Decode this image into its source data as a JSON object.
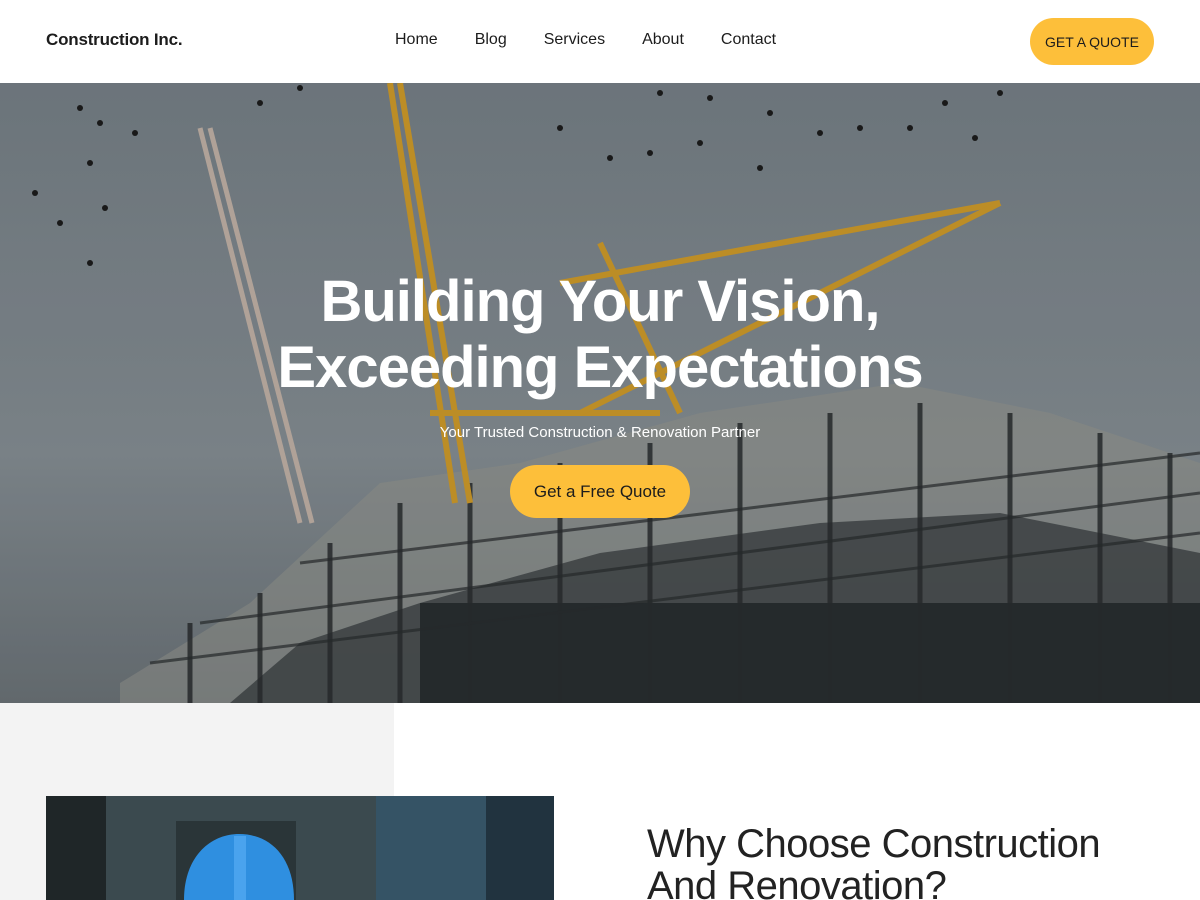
{
  "header": {
    "logo": "Construction Inc.",
    "nav": [
      "Home",
      "Blog",
      "Services",
      "About",
      "Contact"
    ],
    "cta_label": "GET A QUOTE"
  },
  "hero": {
    "title_line1": "Building Your Vision,",
    "title_line2": "Exceeding Expectations",
    "subtitle": "Your Trusted Construction & Renovation Partner",
    "button_label": "Get a Free Quote"
  },
  "why": {
    "title_line1": "Why Choose Construction",
    "title_line2": "And Renovation?"
  },
  "colors": {
    "accent": "#fdbf3a",
    "text": "#1c1c1c",
    "sky": "#7f8a92",
    "gray_block": "#f3f3f3"
  }
}
